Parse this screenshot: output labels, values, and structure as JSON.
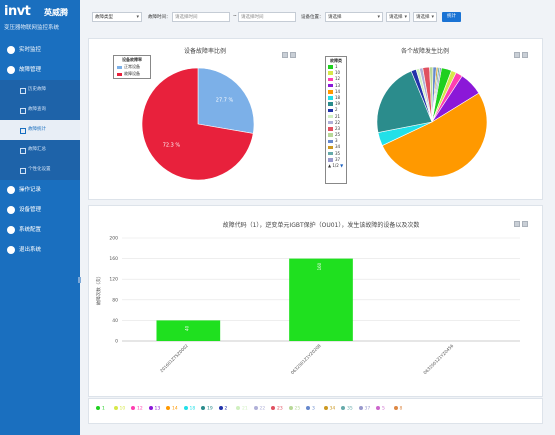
{
  "app": {
    "brand": "invt",
    "brand_cn": "英威腾",
    "subtitle": "变压器物联网监控系统"
  },
  "nav": [
    {
      "label": "实时监控"
    },
    {
      "label": "故障管理"
    },
    {
      "label": "操作记录"
    },
    {
      "label": "设备管理"
    },
    {
      "label": "系统配置"
    },
    {
      "label": "退出系统"
    }
  ],
  "subnav": [
    {
      "label": "历史故障"
    },
    {
      "label": "故障查询"
    },
    {
      "label": "故障统计"
    },
    {
      "label": "故障汇总"
    },
    {
      "label": "个性化设置"
    }
  ],
  "filter": {
    "type_label": "故障类型",
    "type_value": "",
    "start_label": "故障时间：",
    "start_placeholder": "请选择时间",
    "sep": "~",
    "end_placeholder": "请选择时间",
    "location_label": "设备位置：",
    "location_value": "请选择",
    "select2_value": "请选择",
    "select3_value": "请选择",
    "submit_label": "统计"
  },
  "pie1": {
    "title": "设备故障率比例",
    "legend_title": "设备故障率",
    "slices": [
      {
        "name": "正常设备",
        "value": 27.7,
        "label": "27.7 %",
        "color": "#7cb0e8"
      },
      {
        "name": "故障设备",
        "value": 72.3,
        "label": "72.3 %",
        "color": "#e8213c"
      }
    ]
  },
  "pie2": {
    "title": "各个故障发生比例",
    "legend_title": "故障类",
    "page_label": "1/2",
    "slices": [
      {
        "name": "1",
        "value": 3,
        "color": "#1fd01f"
      },
      {
        "name": "10",
        "value": 1.5,
        "color": "#d7e84a"
      },
      {
        "name": "12",
        "value": 2,
        "color": "#ff3fb1"
      },
      {
        "name": "13",
        "value": 7,
        "color": "#8b18d8"
      },
      {
        "name": "14",
        "value": 52,
        "color": "#ff9900"
      },
      {
        "name": "18",
        "value": 4,
        "color": "#22e0e8"
      },
      {
        "name": "19",
        "value": 22,
        "color": "#2b8c8c"
      },
      {
        "name": "2",
        "value": 1.5,
        "color": "#2233aa"
      },
      {
        "name": "21",
        "value": 1,
        "color": "#d0f0c0"
      },
      {
        "name": "22",
        "value": 1,
        "color": "#b0b0d8"
      },
      {
        "name": "23",
        "value": 2,
        "color": "#e05060"
      },
      {
        "name": "25",
        "value": 1,
        "color": "#b8d898"
      },
      {
        "name": "3",
        "value": 1,
        "color": "#6688cc"
      },
      {
        "name": "34",
        "value": 0.5,
        "color": "#cc9922"
      },
      {
        "name": "35",
        "value": 0.5,
        "color": "#66aaaa"
      },
      {
        "name": "37",
        "value": 0.5,
        "color": "#9999cc"
      }
    ]
  },
  "bottom_legend": [
    {
      "name": "1",
      "color": "#1fd01f"
    },
    {
      "name": "10",
      "color": "#d7e84a"
    },
    {
      "name": "12",
      "color": "#ff3fb1"
    },
    {
      "name": "13",
      "color": "#8b18d8"
    },
    {
      "name": "14",
      "color": "#ff9900"
    },
    {
      "name": "18",
      "color": "#22e0e8"
    },
    {
      "name": "19",
      "color": "#2b8c8c"
    },
    {
      "name": "2",
      "color": "#2233aa"
    },
    {
      "name": "21",
      "color": "#d0f0c0"
    },
    {
      "name": "22",
      "color": "#b0b0d8"
    },
    {
      "name": "23",
      "color": "#e05060"
    },
    {
      "name": "25",
      "color": "#b8d898"
    },
    {
      "name": "3",
      "color": "#6688cc"
    },
    {
      "name": "34",
      "color": "#cc9922"
    },
    {
      "name": "35",
      "color": "#66aaaa"
    },
    {
      "name": "37",
      "color": "#9999cc"
    },
    {
      "name": "5",
      "color": "#cc66cc"
    },
    {
      "name": "8",
      "color": "#dd8844"
    }
  ],
  "chart_data": {
    "type": "bar",
    "title": "故障代码（1），逆变单元IGBT保护（OU01），发生该故障的设备以及次数",
    "ylabel": "故障次数（次）",
    "xlabel": "",
    "categories": [
      "201601ZTSZ0002",
      "0632S01Z1YZ0208",
      "0632S01Z1YZ0456"
    ],
    "values": [
      40,
      160,
      0
    ],
    "ylim": [
      0,
      200
    ],
    "yticks": [
      0,
      40,
      80,
      120,
      160,
      200
    ],
    "bar_color": "#1fe01f",
    "grid": true
  }
}
